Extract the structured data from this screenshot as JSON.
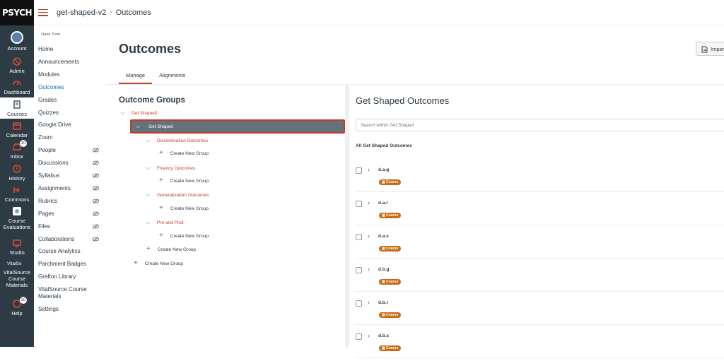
{
  "global_nav": {
    "logo_text": "PSYCH",
    "items": [
      {
        "label": "Account",
        "icon": "avatar"
      },
      {
        "label": "Admin",
        "icon": "shield-icon"
      },
      {
        "label": "Dashboard",
        "icon": "dashboard-icon"
      },
      {
        "label": "Courses",
        "icon": "book-icon"
      },
      {
        "label": "Calendar",
        "icon": "calendar-icon"
      },
      {
        "label": "Inbox",
        "icon": "inbox-icon",
        "badge": "10"
      },
      {
        "label": "History",
        "icon": "clock-icon"
      },
      {
        "label": "Commons",
        "icon": "commons-icon"
      },
      {
        "label": "Course Evaluations",
        "icon": "evaluations-icon"
      },
      {
        "label": "Studio",
        "icon": "studio-icon"
      },
      {
        "label": "VitalSource Course Materials",
        "icon": "vitalsource-icon",
        "icon_alt": "VitalSo"
      },
      {
        "label": "Help",
        "icon": "help-icon",
        "badge": "10"
      }
    ]
  },
  "breadcrumb": {
    "course": "get-shaped-v2",
    "page": "Outcomes"
  },
  "course_nav": {
    "term": "Open Term",
    "items": [
      {
        "label": "Home"
      },
      {
        "label": "Announcements"
      },
      {
        "label": "Modules"
      },
      {
        "label": "Outcomes",
        "active": true
      },
      {
        "label": "Grades"
      },
      {
        "label": "Quizzes"
      },
      {
        "label": "Google Drive"
      },
      {
        "label": "Zoom"
      },
      {
        "label": "People",
        "hidden": true
      },
      {
        "label": "Discussions",
        "hidden": true
      },
      {
        "label": "Syllabus",
        "hidden": true
      },
      {
        "label": "Assignments",
        "hidden": true
      },
      {
        "label": "Rubrics",
        "hidden": true
      },
      {
        "label": "Pages",
        "hidden": true
      },
      {
        "label": "Files",
        "hidden": true
      },
      {
        "label": "Collaborations",
        "hidden": true
      },
      {
        "label": "Course Analytics"
      },
      {
        "label": "Parchment Badges"
      },
      {
        "label": "Grafton Library"
      },
      {
        "label": "VitalSource Course Materials"
      },
      {
        "label": "Settings"
      }
    ]
  },
  "main": {
    "title": "Outcomes",
    "import_label": "Impor",
    "tabs": [
      {
        "label": "Manage",
        "active": true
      },
      {
        "label": "Alignments"
      }
    ],
    "outcome_groups_title": "Outcome Groups",
    "tree": {
      "root": "Get Shaped!",
      "selected": "Get Shaped",
      "groups": [
        "Discrimination Outcomes",
        "Fluency Outcomes",
        "Generalization Outcomes",
        "Pre and Post"
      ],
      "create_new_group": "Create New Group"
    }
  },
  "right_pane": {
    "title": "Get Shaped Outcomes",
    "search_placeholder": "Search within Get Shaped",
    "all_label": "All Get Shaped Outcomes",
    "badge_label": "Course",
    "outcomes": [
      "d.a.g",
      "d.a.r",
      "d.a.s",
      "d.b.g",
      "d.b.r",
      "d.b.s"
    ]
  },
  "colors": {
    "accent": "#c23c2d",
    "nav_bg": "#2d3b45",
    "badge": "#c96a16",
    "link": "#0374b5"
  }
}
